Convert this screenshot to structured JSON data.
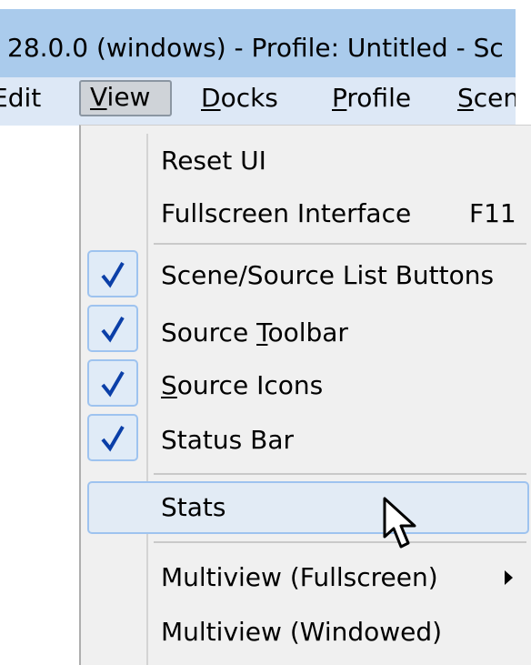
{
  "window": {
    "title": "28.0.0 (windows) - Profile: Untitled - Sc"
  },
  "menubar": {
    "items": [
      {
        "label": "Edit",
        "mnemonic_visible": false
      },
      {
        "label": "View",
        "mnemonic": "V"
      },
      {
        "label": "Docks",
        "mnemonic": "D"
      },
      {
        "label": "Profile",
        "mnemonic": "P"
      },
      {
        "label": "Scen",
        "mnemonic": "S"
      }
    ]
  },
  "view_menu": {
    "items": [
      {
        "label": "Reset UI",
        "checked": false
      },
      {
        "label": "Fullscreen Interface",
        "shortcut": "F11",
        "checked": false
      },
      {
        "label": "Scene/Source List Buttons",
        "checked": true
      },
      {
        "label_pre": "Source ",
        "label_mn": "T",
        "label_post": "oolbar",
        "checked": true
      },
      {
        "label_mn": "S",
        "label_post": "ource Icons",
        "checked": true
      },
      {
        "label": "Status Bar",
        "checked": true
      },
      {
        "label": "Stats",
        "checked": false,
        "hovered": true
      },
      {
        "label": "Multiview (Fullscreen)",
        "has_submenu": true
      },
      {
        "label": "Multiview (Windowed)"
      }
    ]
  },
  "colors": {
    "titlebar": "#aacbec",
    "menubar": "#dde8f6",
    "checkmark": "#0b3fa8",
    "highlight_border": "#9ec3ef"
  }
}
